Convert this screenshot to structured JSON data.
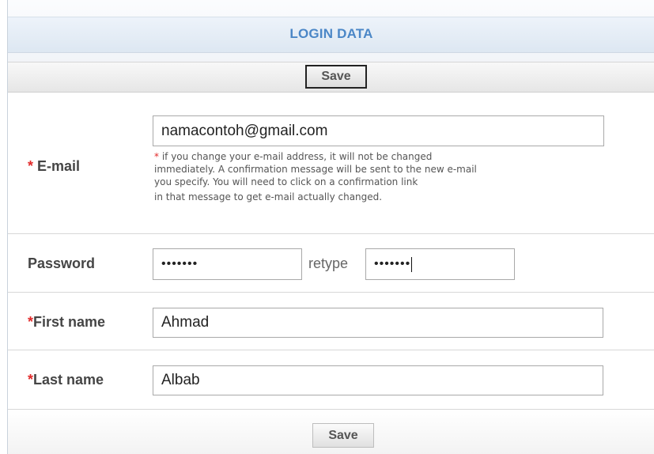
{
  "header": {
    "title": "LOGIN DATA"
  },
  "actions": {
    "save_top_label": "Save",
    "save_bottom_label": "Save"
  },
  "form": {
    "email": {
      "required_mark": "*",
      "label": "E-mail",
      "value": "namacontoh@gmail.com",
      "note_star": "*",
      "note_lines": [
        " if you change your e-mail address, it will not be changed",
        "immediately. A confirmation message will be sent to the new e-mail",
        "you specify. You will need to click on a confirmation link",
        "in that message to get e-mail actually changed."
      ]
    },
    "password": {
      "label": "Password",
      "value_masked": "•••••••",
      "retype_label": "retype",
      "retype_masked": "•••••••"
    },
    "first_name": {
      "required_mark": "*",
      "label": "First name",
      "value": "Ahmad"
    },
    "last_name": {
      "required_mark": "*",
      "label": "Last name",
      "value": "Albab"
    }
  },
  "colors": {
    "title": "#4b87c7",
    "required": "#e22a2a",
    "label": "#454545"
  }
}
